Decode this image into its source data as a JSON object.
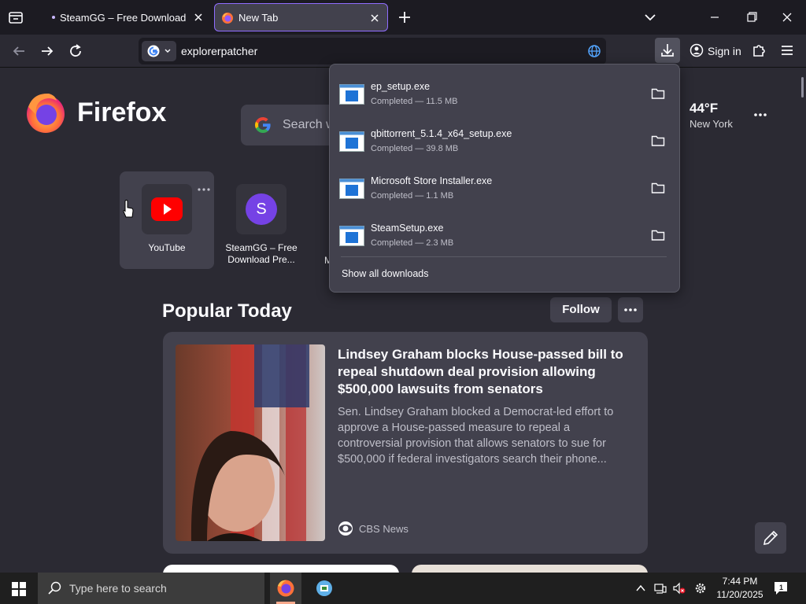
{
  "tabs": [
    {
      "title": "SteamGG – Free Download Pre-"
    },
    {
      "title": "New Tab"
    }
  ],
  "urlbar": {
    "value": "explorerpatcher"
  },
  "toolbar": {
    "signin_label": "Sign in"
  },
  "newtab": {
    "logo_text": "Firefox",
    "search_placeholder": "Search w",
    "weather": {
      "temp": "44°F",
      "city": "New York"
    },
    "shortcuts": [
      {
        "label": "YouTube"
      },
      {
        "label": "SteamGG – Free Download Pre...",
        "letter": "S"
      },
      {
        "label": "M"
      }
    ],
    "section_title": "Popular Today",
    "follow_label": "Follow",
    "story": {
      "headline": "Lindsey Graham blocks House-passed bill to repeal shutdown deal provision allowing $500,000 lawsuits from senators",
      "excerpt": "Sen. Lindsey Graham blocked a Democrat-led effort to approve a House-passed measure to repeal a controversial provision that allows senators to sue for $500,000 if federal investigators search their phone...",
      "source": "CBS News"
    }
  },
  "downloads": {
    "items": [
      {
        "name": "ep_setup.exe",
        "status": "Completed — 11.5 MB"
      },
      {
        "name": "qbittorrent_5.1.4_x64_setup.exe",
        "status": "Completed — 39.8 MB"
      },
      {
        "name": "Microsoft Store Installer.exe",
        "status": "Completed — 1.1 MB"
      },
      {
        "name": "SteamSetup.exe",
        "status": "Completed — 2.3 MB"
      }
    ],
    "show_all_label": "Show all downloads"
  },
  "taskbar": {
    "search_placeholder": "Type here to search",
    "time": "7:44 PM",
    "date": "11/20/2025",
    "notification_count": "1"
  },
  "colors": {
    "accent": "#8f6cff",
    "tabstrip_bg": "#1c1b22",
    "content_bg": "#2b2a33",
    "card_bg": "#42414d",
    "taskbar_bg": "#1f1f1f"
  }
}
